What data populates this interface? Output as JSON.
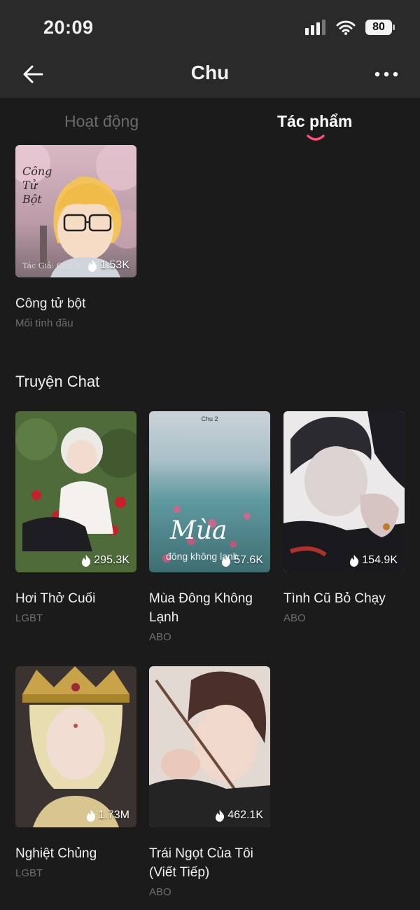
{
  "status_bar": {
    "time": "20:09",
    "battery": "80"
  },
  "header": {
    "title": "Chu"
  },
  "tabs": [
    {
      "label": "Hoạt động",
      "active": false
    },
    {
      "label": "Tác phẩm",
      "active": true
    }
  ],
  "works": [
    {
      "title": "Công tử bột",
      "tag": "Mối tình đầu",
      "views": "1.53K",
      "cover_text": "Công Tử Bột",
      "cover_author": "Tác Giả: Chu 2"
    }
  ],
  "chat_section": {
    "title": "Truyện Chat",
    "items": [
      {
        "title": "Hơi Thở Cuối",
        "tag": "LGBT",
        "views": "295.3K"
      },
      {
        "title": "Mùa Đông Không Lạnh",
        "tag": "ABO",
        "views": "57.6K",
        "cover_top": "Chu 2",
        "cover_title": "Mùa",
        "cover_sub": "đông không lạnh"
      },
      {
        "title": "Tình Cũ Bỏ Chạy",
        "tag": "ABO",
        "views": "154.9K"
      },
      {
        "title": "Nghiệt Chủng",
        "tag": "LGBT",
        "views": "1.73M"
      },
      {
        "title": "Trái Ngọt Của Tôi (Viết Tiếp)",
        "tag": "ABO",
        "views": "462.1K"
      }
    ]
  },
  "colors": {
    "background": "#1b1b1c",
    "header": "#2a2a2b",
    "accent": "#ff4d6d",
    "muted": "#6e6e70"
  }
}
